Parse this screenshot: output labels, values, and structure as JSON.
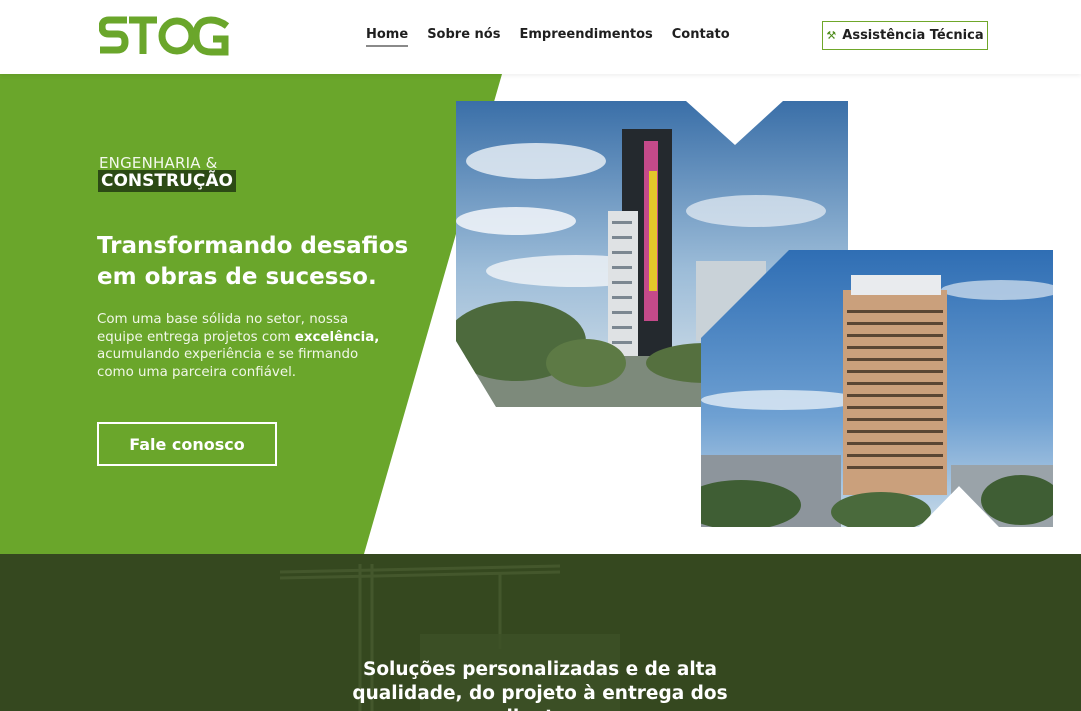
{
  "brand": {
    "logo_text": "STOG",
    "accent": "#6aa62b",
    "dark_accent": "#35481f"
  },
  "nav": {
    "items": [
      {
        "label": "Home",
        "active": true
      },
      {
        "label": "Sobre nós"
      },
      {
        "label": "Empreendimentos"
      },
      {
        "label": "Contato"
      }
    ],
    "assist_button": {
      "icon": "tools-icon",
      "label": "Assistência Técnica"
    }
  },
  "hero": {
    "kicker_line1": "ENGENHARIA &",
    "kicker_line2": "CONSTRUÇÃO",
    "headline": "Transformando desafios em obras de sucesso.",
    "desc_before": "Com uma base sólida no setor, nossa equipe entrega projetos com ",
    "desc_bold": "excelência,",
    "desc_after": " acumulando experiência e se firmando como uma parceira confiável.",
    "cta": "Fale conosco"
  },
  "lower": {
    "title": "Soluções personalizadas e de alta qualidade, do projeto à entrega dos clientes."
  }
}
